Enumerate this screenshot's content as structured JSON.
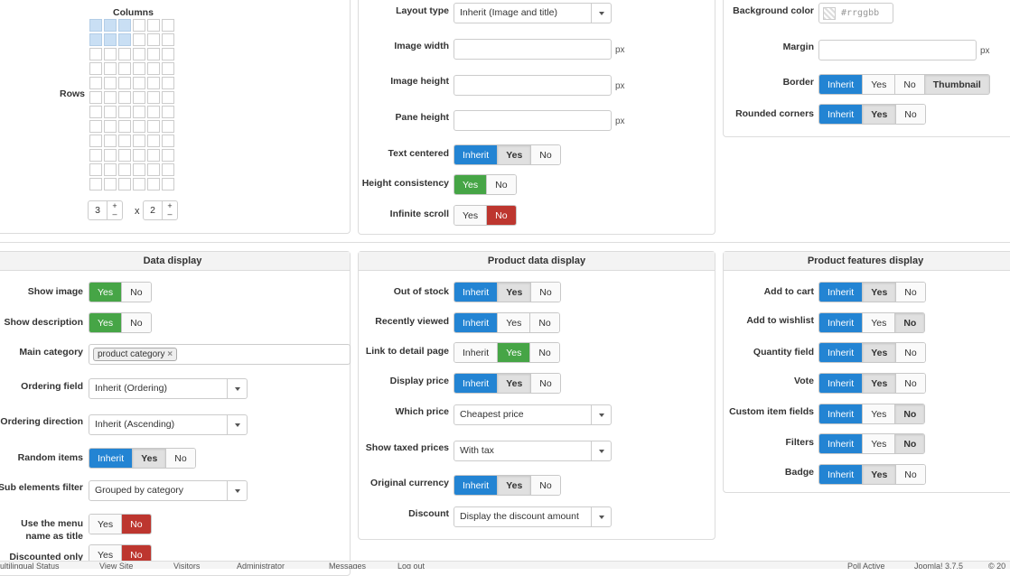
{
  "top_left": {
    "columns_label": "Columns",
    "rows_label": "Rows",
    "rows_value": "3",
    "cols_value": "2",
    "times": "x",
    "plus": "+",
    "minus": "–"
  },
  "top_mid": {
    "layout_type": {
      "label": "Layout type",
      "value": "Inherit (Image and title)"
    },
    "image_width": {
      "label": "Image width",
      "unit": "px"
    },
    "image_height": {
      "label": "Image height",
      "unit": "px"
    },
    "pane_height": {
      "label": "Pane height",
      "unit": "px"
    },
    "text_centered": {
      "label": "Text centered",
      "opts": [
        "Inherit",
        "Yes",
        "No"
      ]
    },
    "height_consistency": {
      "label": "Height consistency",
      "opts": [
        "Yes",
        "No"
      ]
    },
    "infinite_scroll": {
      "label": "Infinite scroll",
      "opts": [
        "Yes",
        "No"
      ]
    }
  },
  "top_right": {
    "bg_color": {
      "label": "Background color",
      "placeholder": "#rrggbb"
    },
    "margin": {
      "label": "Margin",
      "unit": "px"
    },
    "border": {
      "label": "Border",
      "opts": [
        "Inherit",
        "Yes",
        "No",
        "Thumbnail"
      ]
    },
    "rounded": {
      "label": "Rounded corners",
      "opts": [
        "Inherit",
        "Yes",
        "No"
      ]
    }
  },
  "data_display": {
    "title": "Data display",
    "show_image": {
      "label": "Show image",
      "opts": [
        "Yes",
        "No"
      ]
    },
    "show_desc": {
      "label": "Show description",
      "opts": [
        "Yes",
        "No"
      ]
    },
    "main_cat": {
      "label": "Main category",
      "tag": "product category",
      "x": "×"
    },
    "ordering_field": {
      "label": "Ordering field",
      "value": "Inherit (Ordering)"
    },
    "ordering_dir": {
      "label": "Ordering direction",
      "value": "Inherit (Ascending)"
    },
    "random": {
      "label": "Random items",
      "opts": [
        "Inherit",
        "Yes",
        "No"
      ]
    },
    "sub_filter": {
      "label": "Sub elements filter",
      "value": "Grouped by category"
    },
    "menu_title": {
      "label1": "Use the menu",
      "label2": "name as title",
      "opts": [
        "Yes",
        "No"
      ]
    },
    "discounted": {
      "label": "Discounted only",
      "opts": [
        "Yes",
        "No"
      ]
    }
  },
  "product_data": {
    "title": "Product data display",
    "out_of_stock": {
      "label": "Out of stock",
      "opts": [
        "Inherit",
        "Yes",
        "No"
      ]
    },
    "recently": {
      "label": "Recently viewed",
      "opts": [
        "Inherit",
        "Yes",
        "No"
      ]
    },
    "link_detail": {
      "label": "Link to detail page",
      "opts": [
        "Inherit",
        "Yes",
        "No"
      ]
    },
    "display_price": {
      "label": "Display price",
      "opts": [
        "Inherit",
        "Yes",
        "No"
      ]
    },
    "which_price": {
      "label": "Which price",
      "value": "Cheapest price"
    },
    "taxed": {
      "label": "Show taxed prices",
      "value": "With tax"
    },
    "orig_currency": {
      "label": "Original currency",
      "opts": [
        "Inherit",
        "Yes",
        "No"
      ]
    },
    "discount": {
      "label": "Discount",
      "value": "Display the discount amount"
    }
  },
  "features": {
    "title": "Product features display",
    "add_cart": {
      "label": "Add to cart",
      "opts": [
        "Inherit",
        "Yes",
        "No"
      ]
    },
    "wishlist": {
      "label": "Add to wishlist",
      "opts": [
        "Inherit",
        "Yes",
        "No"
      ]
    },
    "qty": {
      "label": "Quantity field",
      "opts": [
        "Inherit",
        "Yes",
        "No"
      ]
    },
    "vote": {
      "label": "Vote",
      "opts": [
        "Inherit",
        "Yes",
        "No"
      ]
    },
    "custom": {
      "label": "Custom item fields",
      "opts": [
        "Inherit",
        "Yes",
        "No"
      ]
    },
    "filters": {
      "label": "Filters",
      "opts": [
        "Inherit",
        "Yes",
        "No"
      ]
    },
    "badge": {
      "label": "Badge",
      "opts": [
        "Inherit",
        "Yes",
        "No"
      ]
    }
  },
  "status_bar": [
    "ultilingual Status",
    "View Site",
    "Visitors",
    "Administrator",
    "Messages",
    "Log out",
    "Poll Active",
    "Joomla! 3.7.5",
    "© 20"
  ]
}
